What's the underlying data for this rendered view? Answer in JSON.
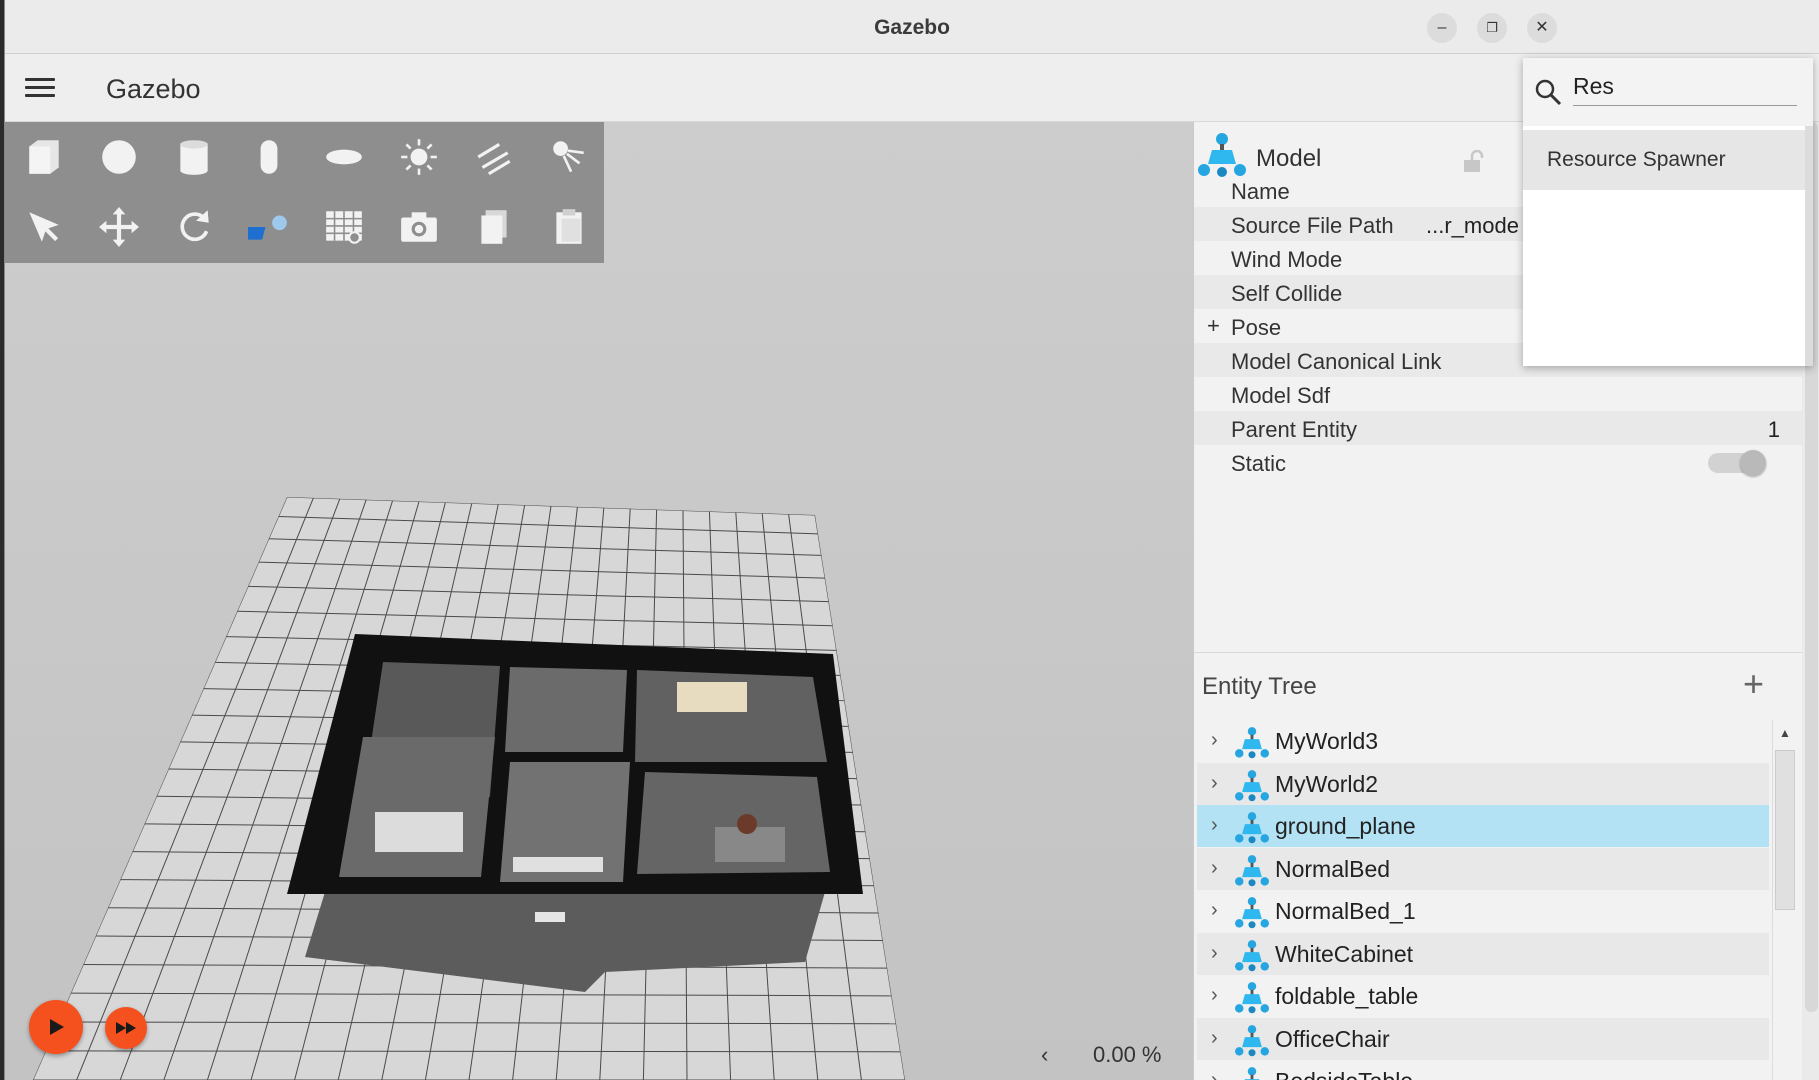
{
  "window": {
    "title": "Gazebo"
  },
  "appbar": {
    "title": "Gazebo"
  },
  "component_inspector": {
    "type_label": "Model",
    "properties": [
      {
        "key": "Name",
        "value": ""
      },
      {
        "key": "Source File Path",
        "value": "...r_mode"
      },
      {
        "key": "Wind Mode",
        "value": ""
      },
      {
        "key": "Self Collide",
        "value": ""
      },
      {
        "key": "Pose",
        "value": ""
      },
      {
        "key": "Model Canonical Link",
        "value": ""
      },
      {
        "key": "Model Sdf",
        "value": ""
      },
      {
        "key": "Parent Entity",
        "value": "1"
      },
      {
        "key": "Static",
        "value": ""
      }
    ]
  },
  "entity_tree": {
    "title": "Entity Tree",
    "items": [
      {
        "name": "MyWorld3"
      },
      {
        "name": "MyWorld2"
      },
      {
        "name": "ground_plane",
        "selected": true
      },
      {
        "name": "NormalBed"
      },
      {
        "name": "NormalBed_1"
      },
      {
        "name": "WhiteCabinet"
      },
      {
        "name": "foldable_table"
      },
      {
        "name": "OfficeChair"
      },
      {
        "name": "BedsideTable"
      }
    ]
  },
  "search": {
    "value": "Res",
    "result": "Resource Spawner"
  },
  "playback": {
    "rtf": "0.00 %",
    "play_icon": "play-icon",
    "step_icon": "fast-forward-icon"
  },
  "colors": {
    "accent": "#f4511e",
    "selection": "#b3e2f4",
    "toolbar": "#8e8e8e"
  }
}
